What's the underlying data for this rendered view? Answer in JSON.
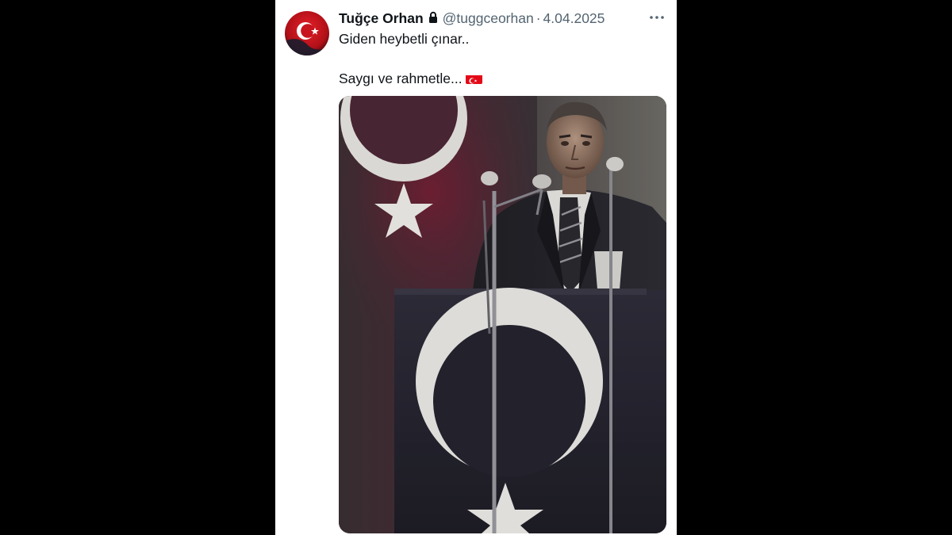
{
  "tweet": {
    "display_name": "Tuğçe Orhan",
    "handle": "@tuggceorhan",
    "separator": "·",
    "date": "4.04.2025",
    "text_line_1": "Giden heybetli çınar..",
    "text_line_2": "Saygı ve rahmetle...",
    "emoji": "turkish-flag-emoji"
  },
  "icons": {
    "lock": "lock-icon",
    "more": "more-options-icon",
    "avatar": "turkish-flag-avatar"
  },
  "colors": {
    "page_background": "#000000",
    "card_background": "#ffffff",
    "primary_text": "#0f1419",
    "secondary_text": "#536471",
    "flag_red": "#e30a17"
  }
}
